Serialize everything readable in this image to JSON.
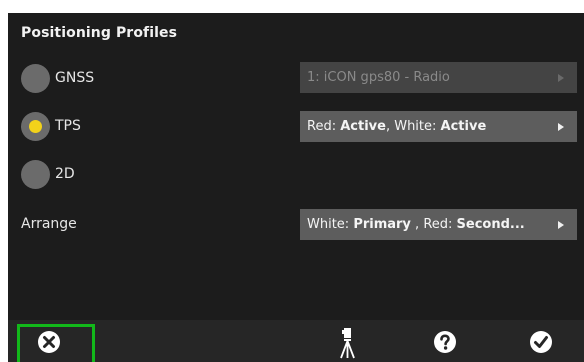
{
  "panel": {
    "title": "Positioning Profiles"
  },
  "profiles": [
    {
      "label": "GNSS",
      "selected": false
    },
    {
      "label": "TPS",
      "selected": true
    },
    {
      "label": "2D",
      "selected": false
    }
  ],
  "gnss_select": {
    "value": "1: iCON gps80 - Radio",
    "enabled": false
  },
  "tps_select": {
    "part1": "Red: ",
    "part1_bold": "Active",
    "part2": ", White: ",
    "part2_bold": "Active"
  },
  "arrange": {
    "label": "Arrange",
    "part1": "White: ",
    "part1_bold": "Primary",
    "part2": " , Red: ",
    "part2_bold": "Second..."
  },
  "colors": {
    "radio_selected": "#f2d21a",
    "highlight": "#12b81a",
    "background": "#1c1c1c"
  },
  "toolbar": {
    "icons": [
      "close-circle-icon",
      "total-station-icon",
      "help-icon",
      "checkmark-icon"
    ]
  }
}
